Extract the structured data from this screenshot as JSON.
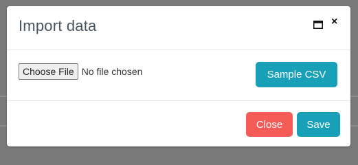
{
  "modal": {
    "title": "Import data",
    "header_icons": {
      "maximize": "maximize-icon",
      "close": "close-icon",
      "close_glyph": "×"
    }
  },
  "file_input": {
    "button_label": "Choose File",
    "status": "No file chosen"
  },
  "actions": {
    "sample_csv_label": "Sample CSV",
    "close_label": "Close",
    "save_label": "Save"
  },
  "colors": {
    "primary": "#17a0b8",
    "danger": "#f55b57",
    "title_text": "#48545f",
    "backdrop": "#7a7a7a"
  }
}
